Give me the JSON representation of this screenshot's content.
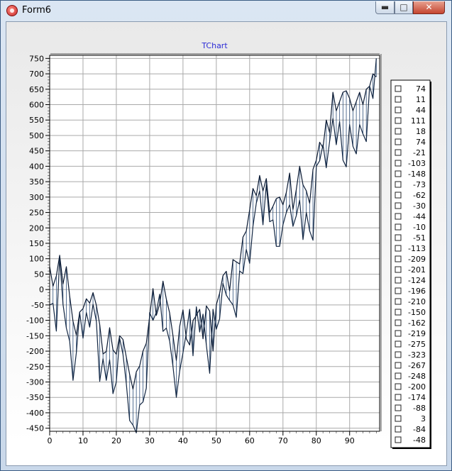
{
  "window": {
    "title": "Form6",
    "minimize_label": "▬",
    "maximize_label": "□",
    "close_label": "✕"
  },
  "chart_data": {
    "type": "line",
    "title": "TChart",
    "xlabel": "",
    "ylabel": "",
    "xlim": [
      0,
      99
    ],
    "ylim": [
      -460,
      760
    ],
    "grid": true,
    "x_ticks": [
      0,
      10,
      20,
      30,
      40,
      50,
      60,
      70,
      80,
      90
    ],
    "y_ticks": [
      750,
      700,
      650,
      600,
      550,
      500,
      450,
      400,
      350,
      300,
      250,
      200,
      150,
      100,
      50,
      0,
      -50,
      -100,
      -150,
      -200,
      -250,
      -300,
      -350,
      -400,
      -450
    ],
    "legend_position": "right",
    "legend_values": [
      "74",
      "11",
      "44",
      "111",
      "18",
      "74",
      "-21",
      "-103",
      "-148",
      "-73",
      "-62",
      "-30",
      "-44",
      "-10",
      "-51",
      "-113",
      "-209",
      "-201",
      "-124",
      "-196",
      "-210",
      "-150",
      "-162",
      "-219",
      "-275",
      "-323",
      "-267",
      "-248",
      "-200",
      "-174",
      "-88",
      "3",
      "-84",
      "-48"
    ],
    "series": [
      {
        "values": [
          74,
          11,
          44,
          111,
          18,
          74,
          -21,
          -103,
          -148,
          -73,
          -62,
          -30,
          -44,
          -10,
          -51,
          -113,
          -209,
          -201,
          -124,
          -196,
          -210,
          -150,
          -162,
          -219,
          -275,
          -323,
          -267,
          -248,
          -200,
          -174,
          -88,
          3,
          -84,
          -48,
          27,
          -31,
          -76,
          -150,
          -230,
          -120,
          -66,
          -160,
          -180,
          -101,
          -84,
          -64,
          -160,
          -53,
          -70,
          -200,
          -50,
          -12,
          45,
          59,
          -4,
          97,
          90,
          83,
          170,
          190,
          258,
          328,
          305,
          370,
          320,
          360,
          250,
          270,
          295,
          300,
          275,
          315,
          378,
          260,
          325,
          400,
          340,
          320,
          280,
          390,
          420,
          478,
          460,
          550,
          510,
          640,
          580,
          610,
          640,
          645,
          620,
          580,
          610,
          640,
          600,
          650,
          660,
          700,
          690
        ]
      },
      {
        "values": [
          -50,
          -45,
          -135,
          105,
          -48,
          -125,
          -168,
          -295,
          -205,
          -75,
          -158,
          -75,
          -122,
          -48,
          -103,
          -298,
          -225,
          -295,
          -228,
          -338,
          -300,
          -158,
          -210,
          -305,
          -425,
          -440,
          -465,
          -375,
          -365,
          -320,
          -75,
          -100,
          -74,
          -15,
          -136,
          -125,
          -168,
          -250,
          -350,
          -265,
          -205,
          -141,
          -64,
          -215,
          -56,
          -138,
          -80,
          -180,
          -272,
          -64,
          -129,
          -95,
          20,
          -18,
          -35,
          -50,
          -90,
          60,
          52,
          130,
          85,
          205,
          280,
          320,
          210,
          340,
          220,
          226,
          140,
          140,
          210,
          250,
          275,
          205,
          240,
          290,
          162,
          250,
          190,
          160,
          400,
          418,
          470,
          395,
          480,
          555,
          470,
          545,
          420,
          398,
          535,
          465,
          440,
          535,
          505,
          480,
          660,
          620,
          750
        ]
      }
    ]
  }
}
